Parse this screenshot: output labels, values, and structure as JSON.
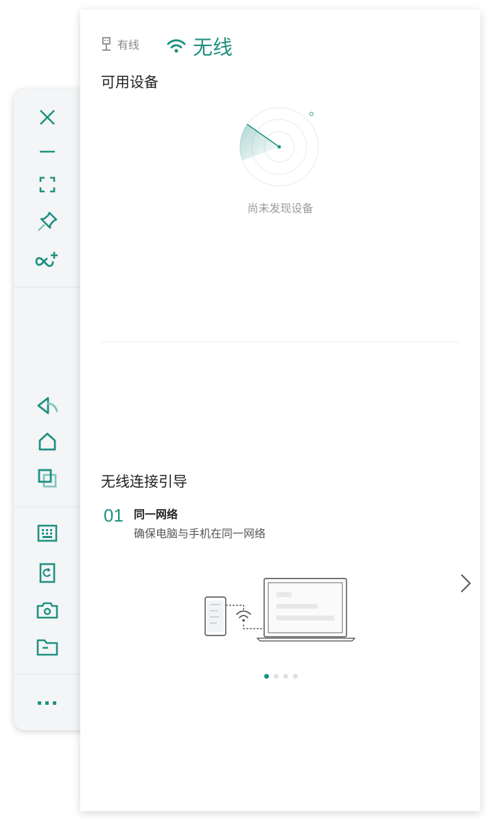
{
  "tabs": {
    "wired_label": "有线",
    "wireless_label": "无线",
    "active": "wireless"
  },
  "devices": {
    "title": "可用设备",
    "empty_text": "尚未发现设备"
  },
  "guide": {
    "title": "无线连接引导",
    "step_number": "01",
    "step_title": "同一网络",
    "step_desc": "确保电脑与手机在同一网络",
    "total_steps": 4,
    "current_step": 1
  },
  "toolbar": {
    "items": [
      "close-icon",
      "minimize-icon",
      "fullscreen-icon",
      "pin-icon",
      "infinity-add-icon",
      "back-icon",
      "home-icon",
      "multitask-icon",
      "keyboard-icon",
      "screen-rotate-icon",
      "screenshot-icon",
      "folder-icon",
      "more-icon"
    ]
  },
  "colors": {
    "accent": "#1e9080",
    "toolbar_bg": "#f3f5f6",
    "text_primary": "#222222",
    "text_secondary": "#999999"
  }
}
